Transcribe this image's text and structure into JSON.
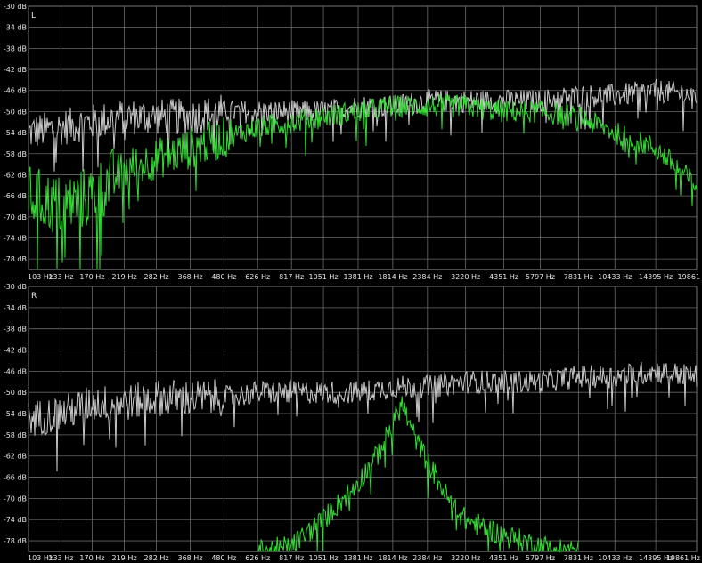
{
  "chart_data": [
    {
      "type": "line",
      "channel_label": "L",
      "x_scale": "log",
      "x_ticks": [
        "103 Hz",
        "133 Hz",
        "170 Hz",
        "219 Hz",
        "282 Hz",
        "368 Hz",
        "480 Hz",
        "626 Hz",
        "817 Hz",
        "1051 Hz",
        "1381 Hz",
        "1814 Hz",
        "2384 Hz",
        "3220 Hz",
        "4351 Hz",
        "5797 Hz",
        "7831 Hz",
        "10433 Hz",
        "14395 Hz",
        "19861"
      ],
      "x_tick_values": [
        103,
        133,
        170,
        219,
        282,
        368,
        480,
        626,
        817,
        1051,
        1381,
        1814,
        2384,
        3220,
        4351,
        5797,
        7831,
        10433,
        14395,
        19861
      ],
      "y_ticks": [
        "-30 dB",
        "-34 dB",
        "-38 dB",
        "-42 dB",
        "-46 dB",
        "-50 dB",
        "-54 dB",
        "-58 dB",
        "-62 dB",
        "-66 dB",
        "-70 dB",
        "-74 dB",
        "-78 dB"
      ],
      "ylim": [
        -80,
        -30
      ],
      "grid": true,
      "series": [
        {
          "color": "#c8c8c8",
          "x": [
            103,
            133,
            170,
            219,
            282,
            368,
            480,
            626,
            817,
            1051,
            1381,
            1814,
            2384,
            3220,
            4351,
            5797,
            7831,
            10433,
            14395,
            19861
          ],
          "values": [
            -54,
            -53,
            -52,
            -51,
            -51,
            -51,
            -50,
            -50,
            -50,
            -50,
            -49,
            -49,
            -48,
            -48,
            -48,
            -48,
            -47,
            -47,
            -46,
            -47
          ]
        },
        {
          "color": "#33dd33",
          "x": [
            103,
            133,
            170,
            219,
            282,
            368,
            480,
            626,
            817,
            1051,
            1381,
            1814,
            2384,
            3220,
            4351,
            5797,
            7831,
            10433,
            14395,
            19861
          ],
          "values": [
            -66,
            -68,
            -66,
            -61,
            -59,
            -57,
            -55,
            -53,
            -52,
            -51,
            -50,
            -49,
            -49,
            -49,
            -50,
            -50,
            -51,
            -54,
            -57,
            -64
          ]
        }
      ]
    },
    {
      "type": "line",
      "channel_label": "R",
      "x_scale": "log",
      "x_ticks": [
        "103 Hz",
        "133 Hz",
        "170 Hz",
        "219 Hz",
        "282 Hz",
        "368 Hz",
        "480 Hz",
        "626 Hz",
        "817 Hz",
        "1051 Hz",
        "1381 Hz",
        "1814 Hz",
        "2384 Hz",
        "3220 Hz",
        "4351 Hz",
        "5797 Hz",
        "7831 Hz",
        "10433 Hz",
        "14395 Hz",
        "19861 Hz"
      ],
      "x_tick_values": [
        103,
        133,
        170,
        219,
        282,
        368,
        480,
        626,
        817,
        1051,
        1381,
        1814,
        2384,
        3220,
        4351,
        5797,
        7831,
        10433,
        14395,
        19861
      ],
      "y_ticks": [
        "-30 dB",
        "-34 dB",
        "-38 dB",
        "-42 dB",
        "-46 dB",
        "-50 dB",
        "-54 dB",
        "-58 dB",
        "-62 dB",
        "-66 dB",
        "-70 dB",
        "-74 dB",
        "-78 dB"
      ],
      "ylim": [
        -80,
        -30
      ],
      "grid": true,
      "series": [
        {
          "color": "#c8c8c8",
          "x": [
            103,
            133,
            170,
            219,
            282,
            368,
            480,
            626,
            817,
            1051,
            1381,
            1814,
            2384,
            3220,
            4351,
            5797,
            7831,
            10433,
            14395,
            19861
          ],
          "values": [
            -55,
            -54,
            -52,
            -52,
            -51,
            -51,
            -51,
            -50,
            -50,
            -50,
            -50,
            -49,
            -49,
            -48,
            -48,
            -48,
            -47,
            -47,
            -46,
            -47
          ]
        },
        {
          "color": "#33dd33",
          "x": [
            626,
            817,
            1051,
            1381,
            1600,
            1814,
            1950,
            2100,
            2384,
            2800,
            3220,
            4351,
            5797,
            7831
          ],
          "values": [
            -80,
            -79,
            -74,
            -67,
            -62,
            -56,
            -52,
            -57,
            -63,
            -70,
            -74,
            -77,
            -79,
            -80
          ]
        }
      ]
    }
  ]
}
